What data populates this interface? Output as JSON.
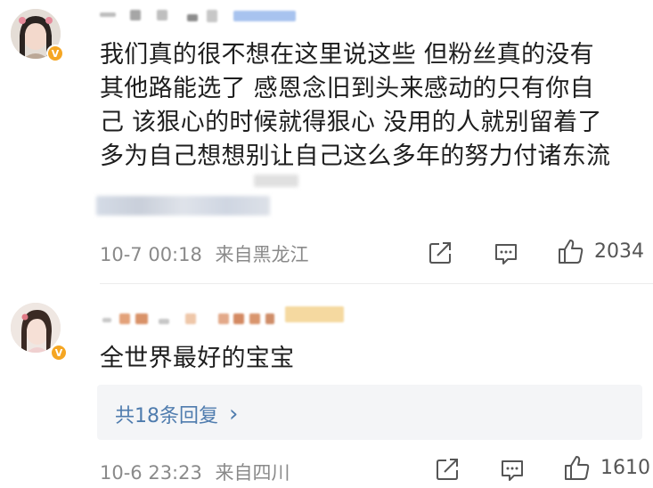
{
  "comments": [
    {
      "body": "我们真的很不想在这里说这些 但粉丝真的没有其他路能选了 感恩念旧到头来感动的只有你自己 该狠心的时候就得狠心 没用的人就别留着了多为自己想想别让自己这么多年的努力付诸东流",
      "lines": [
        "我们真的很不想在这里说这些 但粉丝真的没有",
        "其他路能选了 感恩念旧到头来感动的只有你自",
        "己 该狠心的时候就得狠心 没用的人就别留着了",
        "多为自己想想别让自己这么多年的努力付诸东流"
      ],
      "timestamp": "10-7 00:18",
      "location": "来自黑龙江",
      "like_count": "2034"
    },
    {
      "body": "全世界最好的宝宝",
      "timestamp": "10-6 23:23",
      "location": "来自四川",
      "like_count": "1610",
      "replies_link": "共18条回复",
      "replies_chevron": "›"
    }
  ],
  "badge_icon": "verified-v-badge",
  "colors": {
    "badge": "#f5a623",
    "link": "#4f7cae",
    "meta_text": "#8a8a8a",
    "reply_bg": "#f4f5f7"
  },
  "icons": [
    "share-icon",
    "comment-icon",
    "like-icon"
  ]
}
